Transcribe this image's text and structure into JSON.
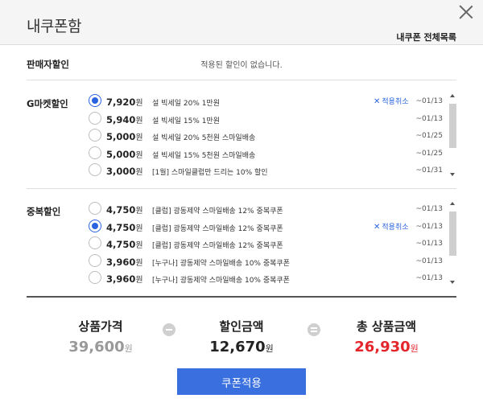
{
  "window": {
    "title": "내쿠폰함",
    "all_coupons_link": "내쿠폰 전체목록"
  },
  "seller_discount": {
    "label": "판매자할인",
    "empty_text": "적용된 할인이 없습니다."
  },
  "gmarket_discount": {
    "label": "G마켓할인",
    "items": [
      {
        "amount": "7,920",
        "unit": "원",
        "desc": "설 빅세일 20% 1만원",
        "date": "~01/13",
        "selected": true,
        "cancel": "적용취소"
      },
      {
        "amount": "5,940",
        "unit": "원",
        "desc": "설 빅세일 15% 1만원",
        "date": "~01/13",
        "selected": false
      },
      {
        "amount": "5,000",
        "unit": "원",
        "desc": "설 빅세일 20% 5천원 스마일배송",
        "date": "~01/25",
        "selected": false
      },
      {
        "amount": "5,000",
        "unit": "원",
        "desc": "설 빅세일 15% 5천원 스마일배송",
        "date": "~01/25",
        "selected": false
      },
      {
        "amount": "3,000",
        "unit": "원",
        "desc": "[1월] 스마일클럽만 드리는 10% 할인",
        "date": "~01/31",
        "selected": false
      }
    ]
  },
  "duplicate_discount": {
    "label": "중복할인",
    "items": [
      {
        "amount": "4,750",
        "unit": "원",
        "desc": "[클럽] 광동제약 스마일배송 12% 중복쿠폰",
        "date": "~01/13",
        "selected": false
      },
      {
        "amount": "4,750",
        "unit": "원",
        "desc": "[클럽] 광동제약 스마일배송 12% 중복쿠폰",
        "date": "~01/13",
        "selected": true,
        "cancel": "적용취소"
      },
      {
        "amount": "4,750",
        "unit": "원",
        "desc": "[클럽] 광동제약 스마일배송 12% 중복쿠폰",
        "date": "~01/13",
        "selected": false
      },
      {
        "amount": "3,960",
        "unit": "원",
        "desc": "[누구나] 광동제약 스마일배송 10% 중복쿠폰",
        "date": "~01/13",
        "selected": false
      },
      {
        "amount": "3,960",
        "unit": "원",
        "desc": "[누구나] 광동제약 스마일배송 10% 중복쿠폰",
        "date": "~01/13",
        "selected": false
      }
    ]
  },
  "summary": {
    "product_price": {
      "label": "상품가격",
      "value": "39,600",
      "unit": "원",
      "color": "#999999"
    },
    "discount": {
      "label": "할인금액",
      "value": "12,670",
      "unit": "원",
      "color": "#222222"
    },
    "total": {
      "label": "총 상품금액",
      "value": "26,930",
      "unit": "원",
      "color": "#e4262c"
    }
  },
  "apply_button": "쿠폰적용",
  "accent_color": "#3a6fe0"
}
